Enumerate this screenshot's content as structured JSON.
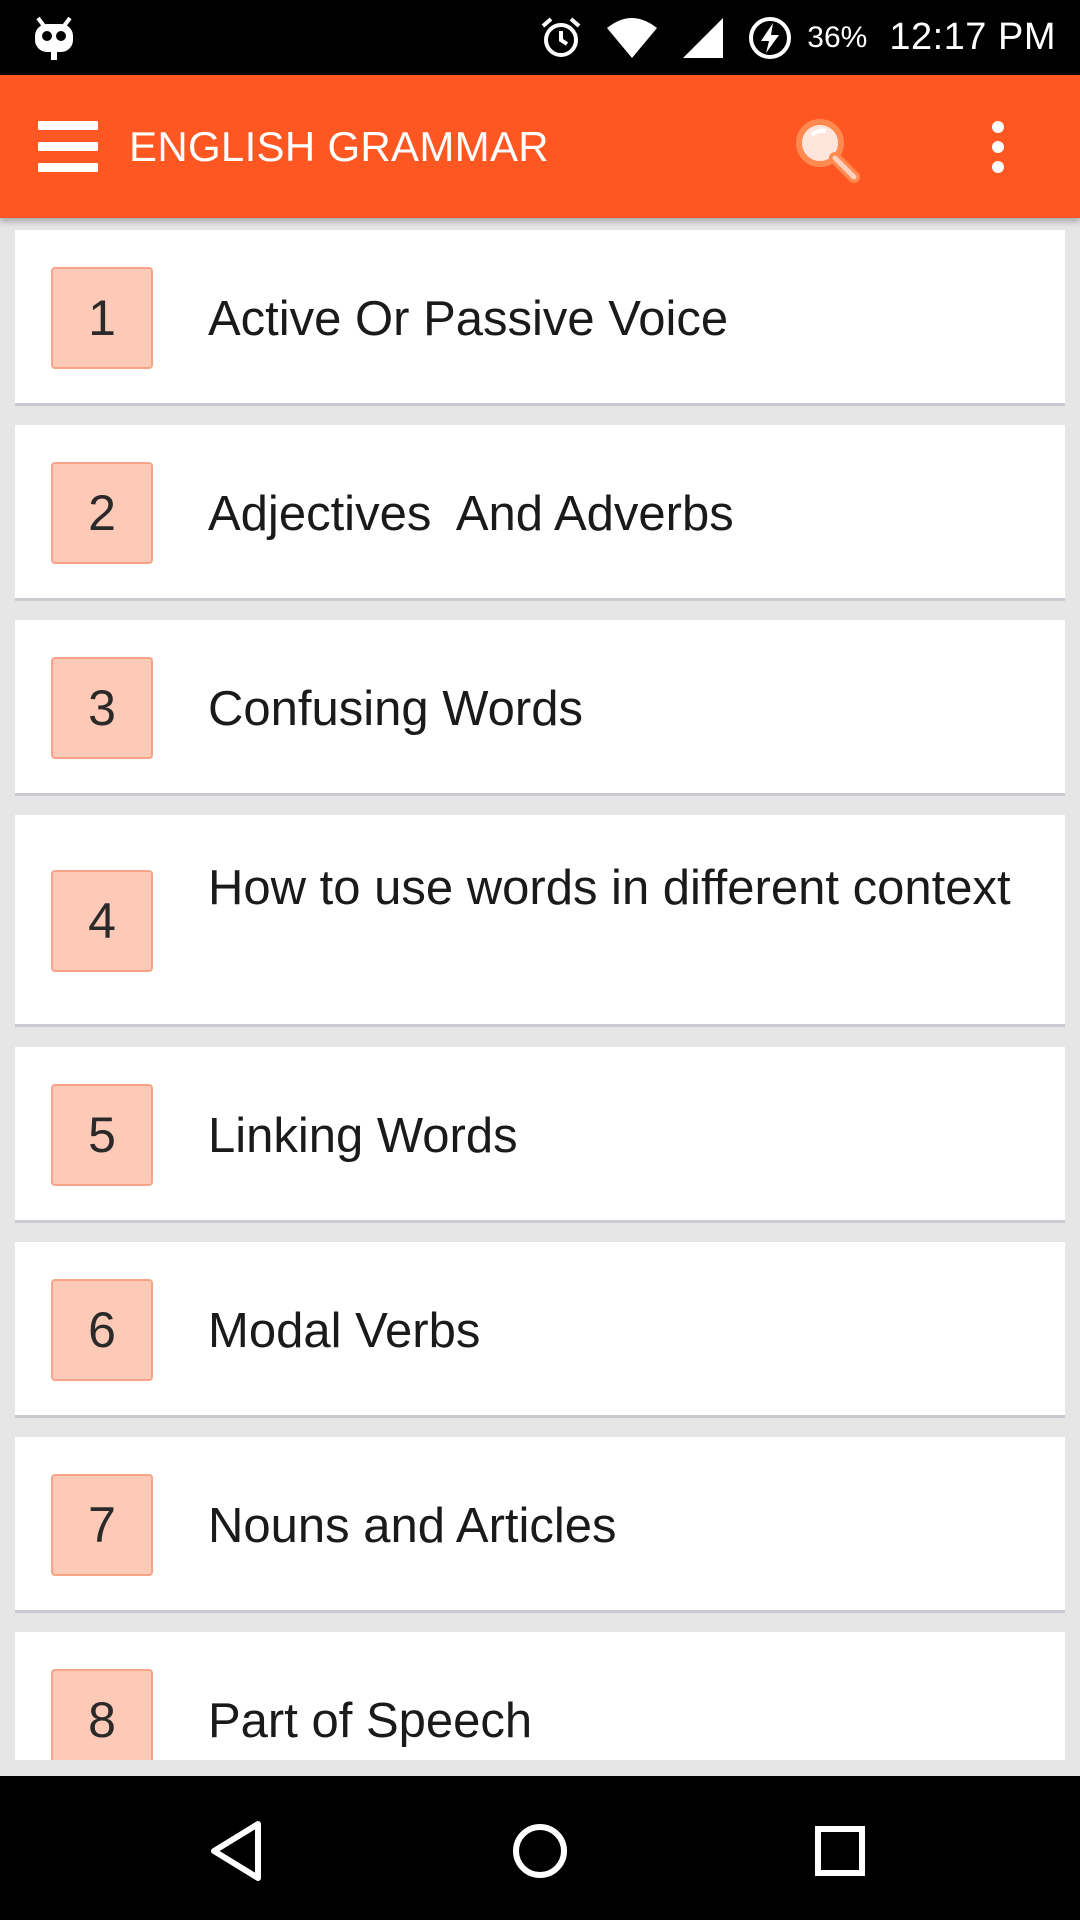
{
  "status_bar": {
    "notification_icon": "cyanogenmod-bugdroid-icon",
    "icons": [
      "alarm-icon",
      "wifi-icon",
      "cell-signal-icon",
      "battery-charging-icon"
    ],
    "battery": "36%",
    "time": "12:17 PM"
  },
  "app_bar": {
    "title": "ENGLISH GRAMMAR",
    "background_color": "#ff5722",
    "icons": [
      "menu-icon",
      "search-icon",
      "more-vert-icon"
    ]
  },
  "topics": [
    {
      "number": "1",
      "title": "Active Or Passive Voice"
    },
    {
      "number": "2",
      "title": "Adjectives  And Adverbs"
    },
    {
      "number": "3",
      "title": "Confusing Words"
    },
    {
      "number": "4",
      "title": "How to use words in different context"
    },
    {
      "number": "5",
      "title": "Linking Words"
    },
    {
      "number": "6",
      "title": "Modal Verbs"
    },
    {
      "number": "7",
      "title": "Nouns and Articles"
    },
    {
      "number": "8",
      "title": "Part of Speech"
    }
  ],
  "colors": {
    "number_box_fill": "#fecab8",
    "number_box_border": "#f6a488"
  },
  "nav_bar": {
    "icons": [
      "back-icon",
      "home-icon",
      "recents-icon"
    ]
  }
}
